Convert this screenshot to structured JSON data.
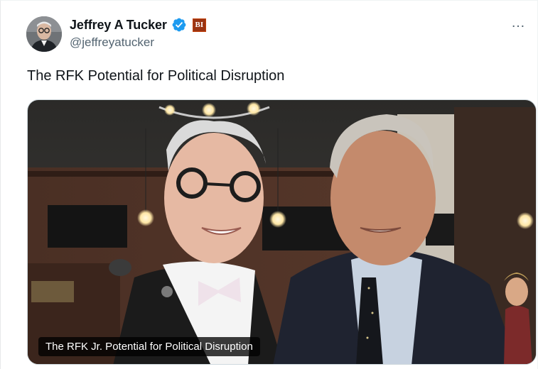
{
  "tweet": {
    "author": {
      "display_name": "Jeffrey A Tucker",
      "handle": "@jeffreyatucker",
      "verified": true,
      "affiliation_badge_text": "BI",
      "affiliation_badge_color": "#9a3412",
      "avatar_icon": "profile-photo"
    },
    "more_menu_icon": "…",
    "text": "The RFK Potential for Political Disruption",
    "media": {
      "caption": "The RFK Jr. Potential for Political Disruption"
    }
  },
  "colors": {
    "primary_text": "#0f1419",
    "secondary_text": "#536471",
    "verified_blue": "#1d9bf0"
  }
}
